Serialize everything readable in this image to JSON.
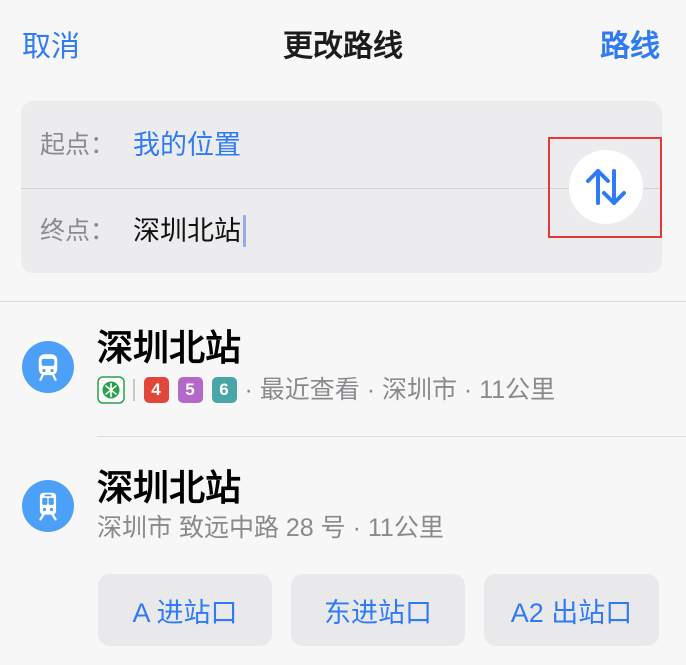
{
  "nav": {
    "cancel_label": "取消",
    "title": "更改路线",
    "route_label": "路线"
  },
  "route_form": {
    "start_label": "起点：",
    "start_value": "我的位置",
    "end_label": "终点：",
    "end_value": "深圳北站",
    "swap_icon": "swap-up-down-arrows-icon"
  },
  "colors": {
    "accent": "#2f7bf5",
    "icon_circle": "#4ca0f7",
    "secondary_text": "#8a8a8e",
    "highlight_box": "#e53935",
    "metro_logo": "#2aa14a"
  },
  "results": [
    {
      "title": "深圳北站",
      "icon": "subway-icon",
      "operator_logo": "shenzhen-metro-logo-icon",
      "lines": [
        {
          "label": "4",
          "color": "#e0463a"
        },
        {
          "label": "5",
          "color": "#b468c9"
        },
        {
          "label": "6",
          "color": "#48a6a6"
        }
      ],
      "meta": "· 最近查看 · 深圳市 · 11公里"
    },
    {
      "title": "深圳北站",
      "icon": "train-icon",
      "meta": "深圳市 致远中路 28 号 · 11公里",
      "entrances": [
        "A 进站口",
        "东进站口",
        "A2 出站口"
      ]
    }
  ]
}
